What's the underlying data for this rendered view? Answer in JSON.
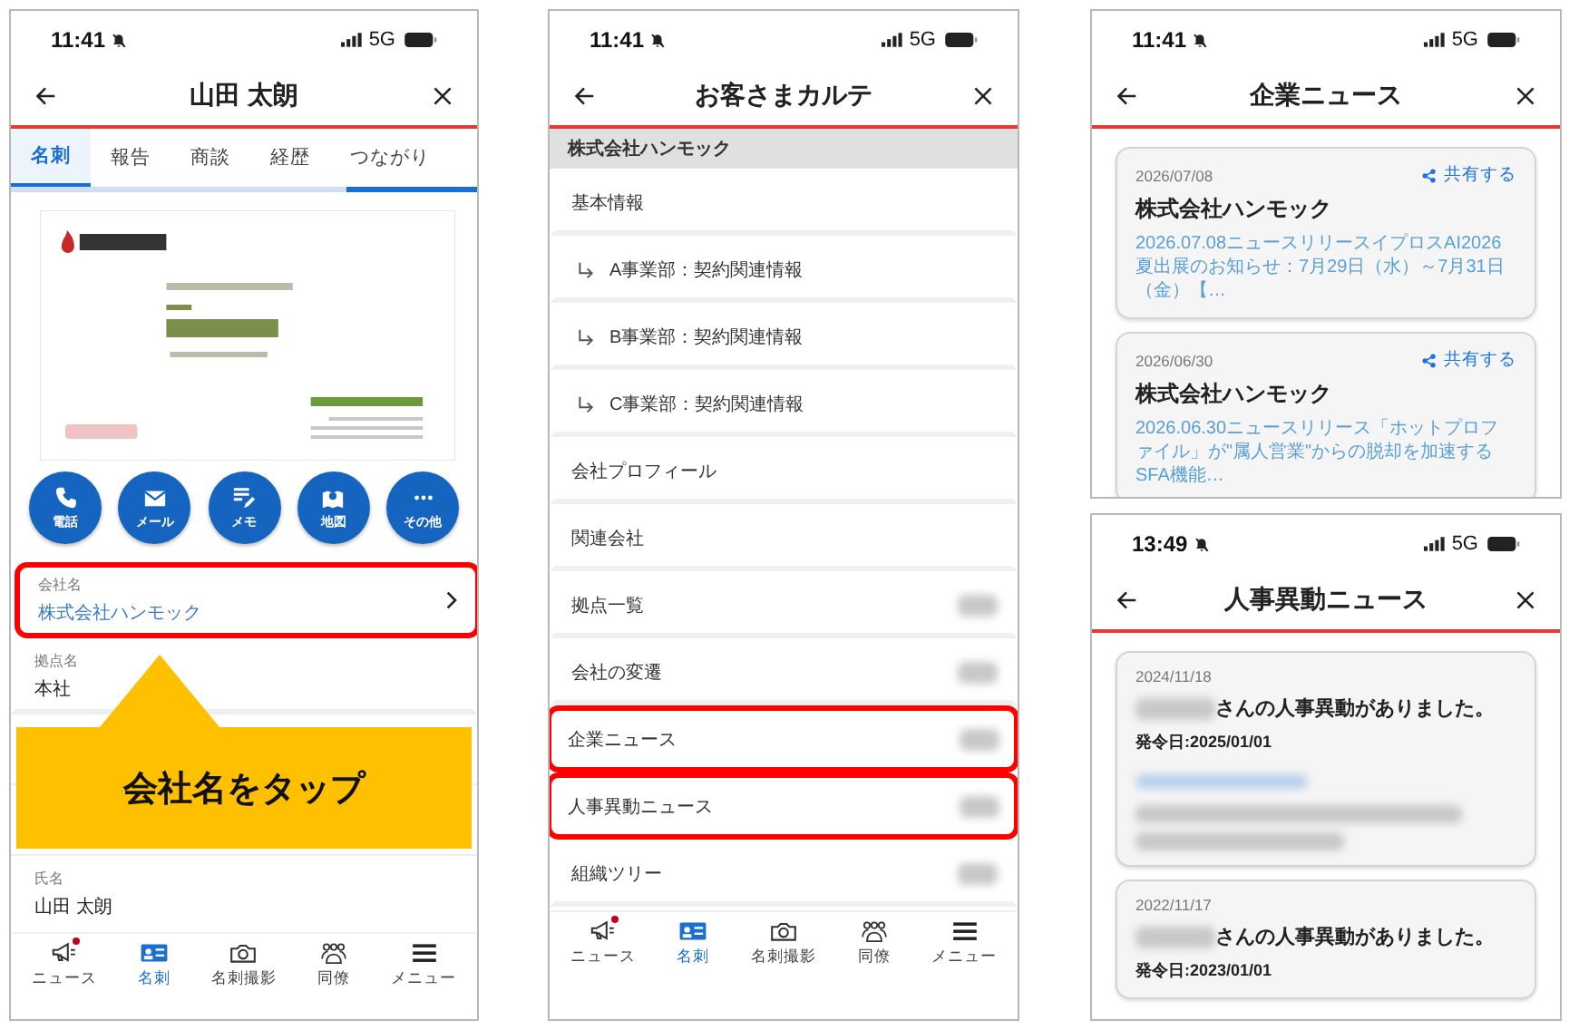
{
  "screens": [
    {
      "kind": "contact",
      "status": {
        "time": "11:41",
        "network": "5G"
      },
      "title": "山田 太朗",
      "tabs": [
        {
          "label": "名刺",
          "selected": true
        },
        {
          "label": "報告",
          "selected": false
        },
        {
          "label": "商談",
          "selected": false
        },
        {
          "label": "経歴",
          "selected": false
        },
        {
          "label": "つながり",
          "selected": false
        }
      ],
      "actions": [
        {
          "kind": "phone",
          "label": "電話"
        },
        {
          "kind": "mail",
          "label": "メール"
        },
        {
          "kind": "memo",
          "label": "メモ"
        },
        {
          "kind": "map",
          "label": "地図"
        },
        {
          "kind": "more",
          "label": "その他"
        }
      ],
      "fields": [
        {
          "label": "会社名",
          "value": "株式会社ハンモック",
          "link": true,
          "highlighted": true
        },
        {
          "label": "拠点名",
          "value": "本社",
          "link": false,
          "highlighted": false
        },
        {
          "label": "氏名",
          "value": "山田 太朗",
          "link": false,
          "highlighted": false
        }
      ],
      "callout": "会社名をタップ",
      "nav": [
        {
          "kind": "news",
          "label": "ニュース",
          "selected": false,
          "dot": true
        },
        {
          "kind": "card",
          "label": "名刺",
          "selected": true,
          "dot": false
        },
        {
          "kind": "camera",
          "label": "名刺撮影",
          "selected": false,
          "dot": false
        },
        {
          "kind": "people",
          "label": "同僚",
          "selected": false,
          "dot": false
        },
        {
          "kind": "menu",
          "label": "メニュー",
          "selected": false,
          "dot": false
        }
      ]
    },
    {
      "kind": "menu",
      "status": {
        "time": "11:41",
        "network": "5G"
      },
      "title": "お客さまカルテ",
      "section": "株式会社ハンモック",
      "items": [
        {
          "label": "基本情報",
          "sub": false,
          "redacted": false,
          "highlighted": false
        },
        {
          "label": "A事業部：契約関連情報",
          "sub": true,
          "redacted": false,
          "highlighted": false
        },
        {
          "label": "B事業部：契約関連情報",
          "sub": true,
          "redacted": false,
          "highlighted": false
        },
        {
          "label": "C事業部：契約関連情報",
          "sub": true,
          "redacted": false,
          "highlighted": false
        },
        {
          "label": "会社プロフィール",
          "sub": false,
          "redacted": false,
          "highlighted": false
        },
        {
          "label": "関連会社",
          "sub": false,
          "redacted": false,
          "highlighted": false
        },
        {
          "label": "拠点一覧",
          "sub": false,
          "redacted": true,
          "highlighted": false
        },
        {
          "label": "会社の変遷",
          "sub": false,
          "redacted": true,
          "highlighted": false
        },
        {
          "label": "企業ニュース",
          "sub": false,
          "redacted": true,
          "highlighted": true
        },
        {
          "label": "人事異動ニュース",
          "sub": false,
          "redacted": true,
          "highlighted": true
        },
        {
          "label": "組織ツリー",
          "sub": false,
          "redacted": true,
          "highlighted": false
        }
      ],
      "nav": [
        {
          "kind": "news",
          "label": "ニュース",
          "selected": false,
          "dot": true
        },
        {
          "kind": "card",
          "label": "名刺",
          "selected": true,
          "dot": false
        },
        {
          "kind": "camera",
          "label": "名刺撮影",
          "selected": false,
          "dot": false
        },
        {
          "kind": "people",
          "label": "同僚",
          "selected": false,
          "dot": false
        },
        {
          "kind": "menu",
          "label": "メニュー",
          "selected": false,
          "dot": false
        }
      ]
    },
    {
      "kind": "news",
      "status": {
        "time": "11:41",
        "network": "5G"
      },
      "title": "企業ニュース",
      "cards": [
        {
          "date": "2026/07/08",
          "share": "共有する",
          "title": "株式会社ハンモック",
          "text": "2026.07.08ニュースリリースイプロスAI2026夏出展のお知らせ：7月29日（水）～7月31日（金）【…"
        },
        {
          "date": "2026/06/30",
          "share": "共有する",
          "title": "株式会社ハンモック",
          "text": "2026.06.30ニュースリリース「ホットプロファイル」が\"属人営業\"からの脱却を加速するSFA機能…"
        }
      ]
    },
    {
      "kind": "personnel",
      "status": {
        "time": "13:49",
        "network": "5G"
      },
      "title": "人事異動ニュース",
      "cards": [
        {
          "date": "2024/11/18",
          "text": "さんの人事異動がありました。",
          "effective": "発令日:2025/01/01",
          "details": true
        },
        {
          "date": "2022/11/17",
          "text": "さんの人事異動がありました。",
          "effective": "発令日:2023/01/01",
          "details": false
        }
      ]
    }
  ]
}
